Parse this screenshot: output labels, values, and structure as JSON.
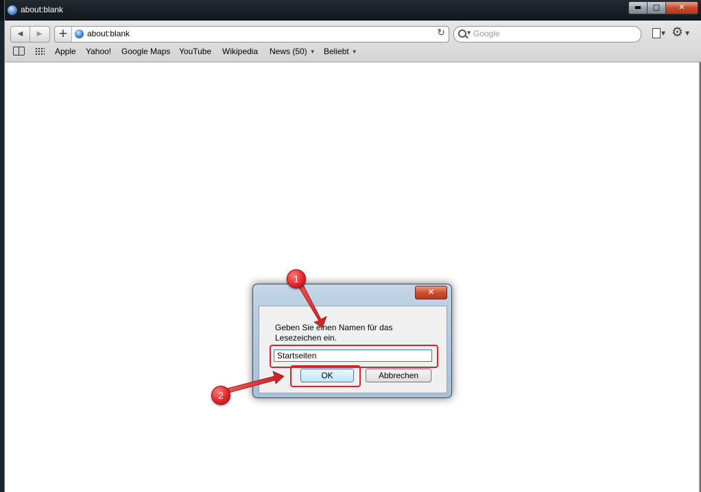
{
  "window": {
    "title": "about:blank"
  },
  "toolbar": {
    "address": "about:blank",
    "search_placeholder": "Google"
  },
  "bookmarks": [
    {
      "label": "Apple"
    },
    {
      "label": "Yahoo!"
    },
    {
      "label": "Google Maps"
    },
    {
      "label": "YouTube"
    },
    {
      "label": "Wikipedia"
    },
    {
      "label": "News (50)"
    },
    {
      "label": "Beliebt"
    }
  ],
  "dialog": {
    "prompt_line1": "Geben Sie einen Namen für das",
    "prompt_line2": "Lesezeichen ein.",
    "input_value": "Startseiten",
    "ok_label": "OK",
    "cancel_label": "Abbrechen",
    "close_label": "✕"
  },
  "annotations": {
    "marker1": "1",
    "marker2": "2",
    "highlight_color": "#e01e26"
  }
}
